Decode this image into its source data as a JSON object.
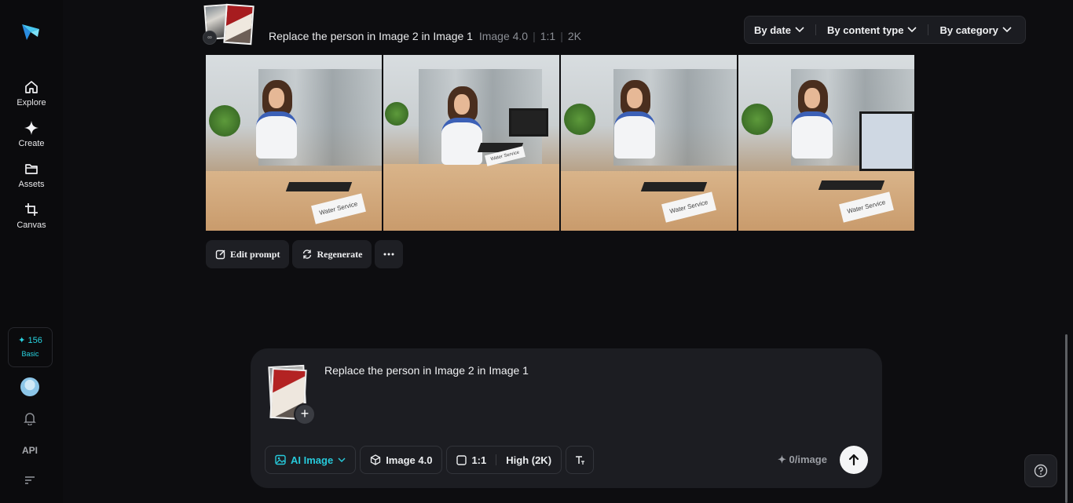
{
  "sidebar": {
    "items": [
      {
        "label": "Explore",
        "icon": "home-icon"
      },
      {
        "label": "Create",
        "icon": "sparkle-icon"
      },
      {
        "label": "Assets",
        "icon": "folder-icon"
      },
      {
        "label": "Canvas",
        "icon": "crop-icon"
      }
    ],
    "credits": {
      "value": "156",
      "plan": "Basic"
    },
    "api_label": "API"
  },
  "generation": {
    "prompt": "Replace the person in Image 2 in Image 1",
    "model": "Image 4.0",
    "ratio": "1:1",
    "resolution": "2K",
    "images": [
      {
        "sign": "Water Service"
      },
      {
        "sign": "Water Service"
      },
      {
        "sign": "Water Service"
      },
      {
        "sign": "Water Service"
      }
    ],
    "actions": {
      "edit": "Edit prompt",
      "regenerate": "Regenerate"
    }
  },
  "filters": {
    "by_date": "By date",
    "by_content_type": "By content type",
    "by_category": "By category"
  },
  "composer": {
    "text": "Replace the person in Image 2 in Image 1",
    "mode": "AI Image",
    "model": "Image 4.0",
    "ratio": "1:1",
    "quality": "High (2K)",
    "cost": "0/image"
  },
  "colors": {
    "accent": "#27c9da",
    "background": "#0d0d10",
    "panel": "#1c1d22"
  }
}
